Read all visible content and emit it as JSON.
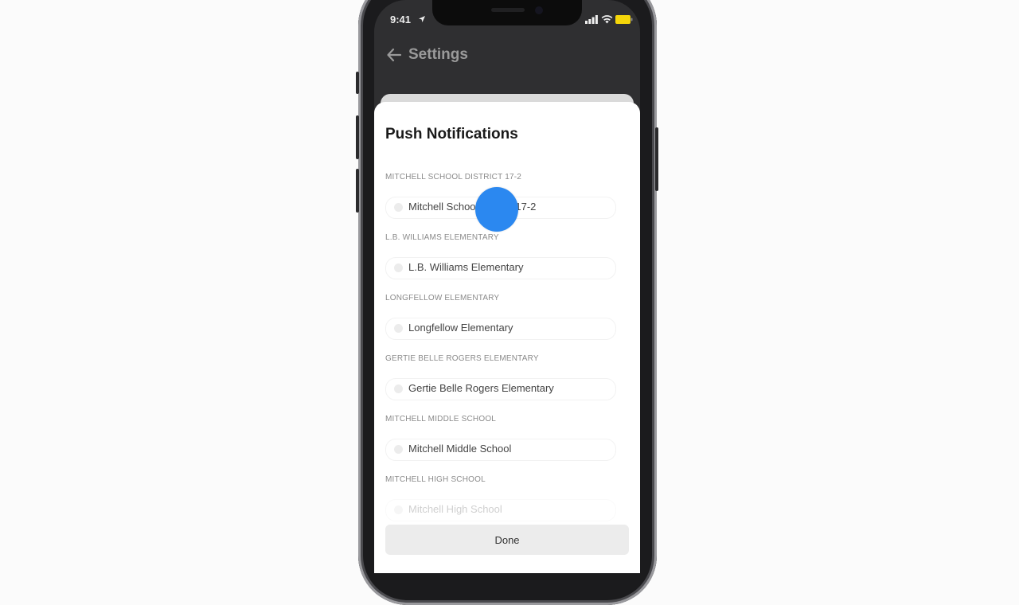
{
  "status_bar": {
    "time": "9:41"
  },
  "header": {
    "title": "Settings"
  },
  "sheet": {
    "title": "Push Notifications",
    "sections": [
      {
        "label": "MITCHELL SCHOOL DISTRICT 17-2",
        "option": "Mitchell School District 17-2"
      },
      {
        "label": "L.B. WILLIAMS ELEMENTARY",
        "option": "L.B. Williams Elementary"
      },
      {
        "label": "LONGFELLOW ELEMENTARY",
        "option": "Longfellow Elementary"
      },
      {
        "label": "GERTIE BELLE ROGERS ELEMENTARY",
        "option": "Gertie Belle Rogers Elementary"
      },
      {
        "label": "MITCHELL MIDDLE SCHOOL",
        "option": "Mitchell Middle School"
      },
      {
        "label": "MITCHELL HIGH SCHOOL",
        "option": "Mitchell High School"
      }
    ],
    "done_label": "Done"
  },
  "colors": {
    "accent_touch": "#2b88f0",
    "battery": "#f5d60a"
  }
}
